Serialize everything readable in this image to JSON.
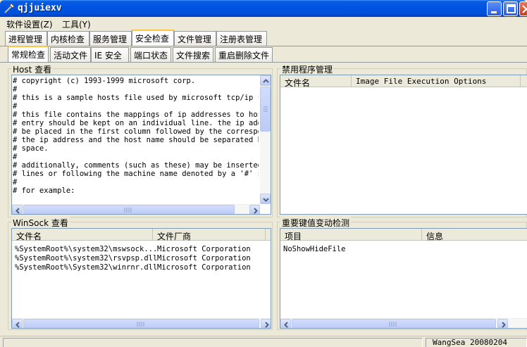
{
  "window": {
    "title": "qjjuiexv"
  },
  "menubar": {
    "items": [
      "软件设置(Z)",
      "工具(Y)"
    ]
  },
  "tabs_primary": [
    "进程管理",
    "内核检查",
    "服务管理",
    "安全检查",
    "文件管理",
    "注册表管理"
  ],
  "tabs_primary_active": "安全检查",
  "tabs_secondary": [
    "常规检查",
    "活动文件",
    "IE 安全",
    "端口状态",
    "文件搜索",
    "重启删除文件"
  ],
  "tabs_secondary_active": "常规检查",
  "host_panel": {
    "title": "Host 查看",
    "lines": [
      "# copyright (c) 1993-1999 microsoft corp.",
      "#",
      "# this is a sample hosts file used by microsoft tcp/ip for",
      "#",
      "# this file contains the mappings of ip addresses to host",
      "# entry should be kept on an individual line. the ip addre",
      "# be placed in the first column followed by the correspond",
      "# the ip address and the host name should be separated by",
      "# space.",
      "#",
      "# additionally, comments (such as these) may be inserted o",
      "# lines or following the machine name denoted by a '#' sym",
      "#",
      "# for example:"
    ]
  },
  "ifeo_panel": {
    "title": "禁用程序管理",
    "columns": [
      "文件名",
      "Image File Execution Options"
    ]
  },
  "winsock_panel": {
    "title": "WinSock 查看",
    "columns": [
      "文件名",
      "文件厂商"
    ],
    "rows": [
      [
        "%SystemRoot%\\system32\\mswsock...",
        "Microsoft Corporation"
      ],
      [
        "%SystemRoot%\\system32\\rsvpsp.dll",
        "Microsoft Corporation"
      ],
      [
        "%SystemRoot%\\System32\\winrnr.dll",
        "Microsoft Corporation"
      ]
    ]
  },
  "regkey_panel": {
    "title": "重要键值变动检测",
    "columns": [
      "项目",
      "信息"
    ],
    "rows": [
      [
        "NoShowHideFile",
        ""
      ]
    ]
  },
  "statusbar": {
    "text": "WangSea 20080204"
  },
  "colors": {
    "titlebar": "#0054e3",
    "face": "#ece9d8",
    "active_tab_accent": "#ffc83c"
  }
}
